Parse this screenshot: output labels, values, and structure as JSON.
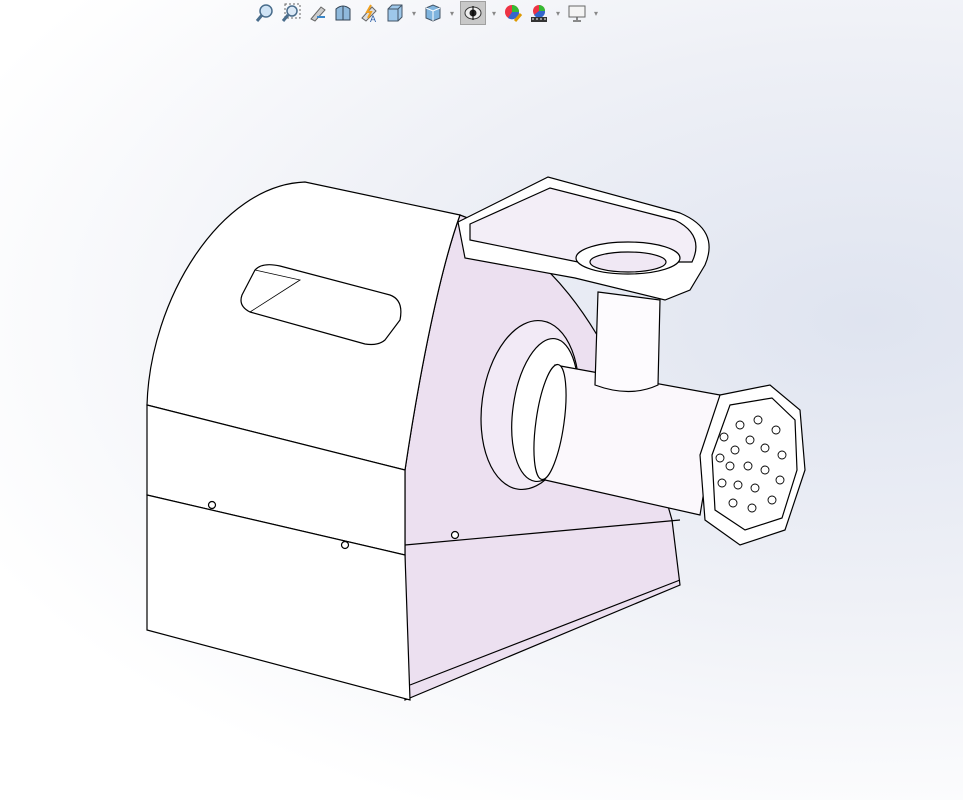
{
  "toolbar": {
    "icons": [
      "zoom-to-fit-icon",
      "zoom-to-area-icon",
      "previous-view-icon",
      "section-view-icon",
      "dynamic-annotation-views-icon",
      "view-orientation-icon",
      "display-style-icon",
      "hide-show-items-icon",
      "edit-appearance-icon",
      "apply-scene-icon",
      "view-settings-icon"
    ]
  },
  "model": {
    "name": "meat-grinder",
    "face_color": "#ffffff",
    "side_color": "#ece0f0",
    "edge_color": "#000000"
  }
}
